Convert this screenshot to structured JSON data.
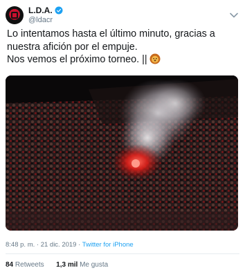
{
  "account": {
    "display_name": "L.D.A.",
    "handle": "@ldacr",
    "verified": true,
    "brand_colors": {
      "red": "#c8102e",
      "black": "#111111"
    }
  },
  "tweet": {
    "line1": "Lo intentamos hasta el último minuto, gracias a nuestra afición por el empuje.",
    "line2": "Nos vemos el próximo torneo. ||",
    "emoji": "lion-face-icon",
    "image": {
      "description_icon": "stadium-flare-photo"
    }
  },
  "meta": {
    "time": "8:48 p. m.",
    "separator": "·",
    "date": "21 dic. 2019",
    "source": "Twitter for iPhone"
  },
  "stats": {
    "retweets_count": "84",
    "retweets_label": "Retweets",
    "likes_count": "1,3 mil",
    "likes_label": "Me gusta"
  },
  "colors": {
    "link": "#1da1f2",
    "secondary_text": "#657786",
    "divider": "#e6ecf0"
  }
}
